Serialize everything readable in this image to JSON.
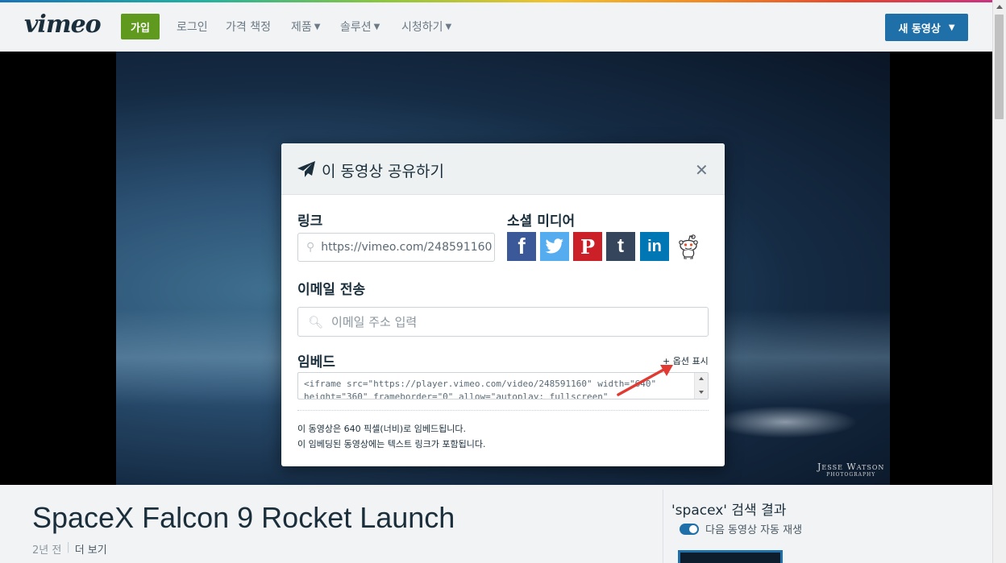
{
  "header": {
    "logo": "vimeo",
    "join_label": "가입",
    "nav": {
      "login": "로그인",
      "pricing": "가격 책정",
      "products": "제품",
      "solutions": "솔루션",
      "watch": "시청하기"
    },
    "new_video_label": "새 동영상"
  },
  "video": {
    "watermark_main": "Jesse Watson",
    "watermark_sub": "Photography"
  },
  "page": {
    "title": "SpaceX Falcon 9 Rocket Launch",
    "age": "2년 전",
    "more": "더 보기",
    "search_result": "'spacex' 검색 결과",
    "autoplay_label": "다음 동영상 자동 재생",
    "autoplay_on": true
  },
  "modal": {
    "title": "이 동영상 공유하기",
    "link_label": "링크",
    "link_value": "https://vimeo.com/248591160",
    "social_label": "소셜 미디어",
    "social": [
      "facebook",
      "twitter",
      "pinterest",
      "tumblr",
      "linkedin",
      "reddit"
    ],
    "email_label": "이메일 전송",
    "email_placeholder": "이메일 주소 입력",
    "embed_label": "임베드",
    "show_options": "+ 옵션 표시",
    "embed_line1": "<iframe src=\"https://player.vimeo.com/video/248591160\" width=\"640\"",
    "embed_line2": "height=\"360\" frameborder=\"0\" allow=\"autoplay; fullscreen\"",
    "note1": "이 동영상은 640 픽셀(너비)로 임베드됩니다.",
    "note2": "이 임베딩된 동영상에는 텍스트 링크가 포함됩니다."
  },
  "colors": {
    "join": "#5f9a1f",
    "primary": "#1f6fa8",
    "annotation_arrow": "#e03a32"
  }
}
